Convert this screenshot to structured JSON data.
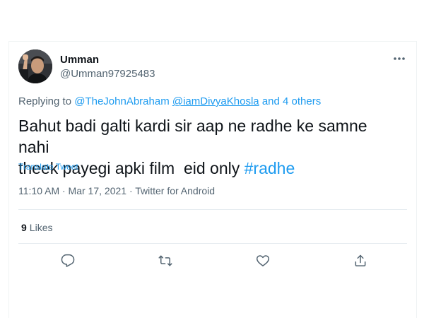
{
  "tweet": {
    "author": {
      "display_name": "Umman",
      "handle": "@Umman97925483"
    },
    "replying": {
      "prefix": "Replying to",
      "mentions": [
        "@TheJohnAbraham",
        "@iamDivyaKhosla"
      ],
      "suffix": "and 4 others"
    },
    "text_main": "Bahut badi galti kardi sir aap ne radhe ke samne nahi\ntheek payegi apki film  eid only ",
    "hashtag": "#radhe",
    "translate_label": "Translate Tweet",
    "timestamp": "11:10 AM · Mar 17, 2021 · Twitter for Android",
    "likes": {
      "count": "9",
      "label": "Likes"
    }
  },
  "actions": {
    "reply_icon": "reply-icon",
    "retweet_icon": "retweet-icon",
    "like_icon": "heart-icon",
    "share_icon": "share-icon",
    "more_icon": "more-icon"
  },
  "colors": {
    "link": "#1d9bf0",
    "secondary_text": "#536471",
    "primary_text": "#0f1419",
    "divider": "#e6ecf0"
  }
}
